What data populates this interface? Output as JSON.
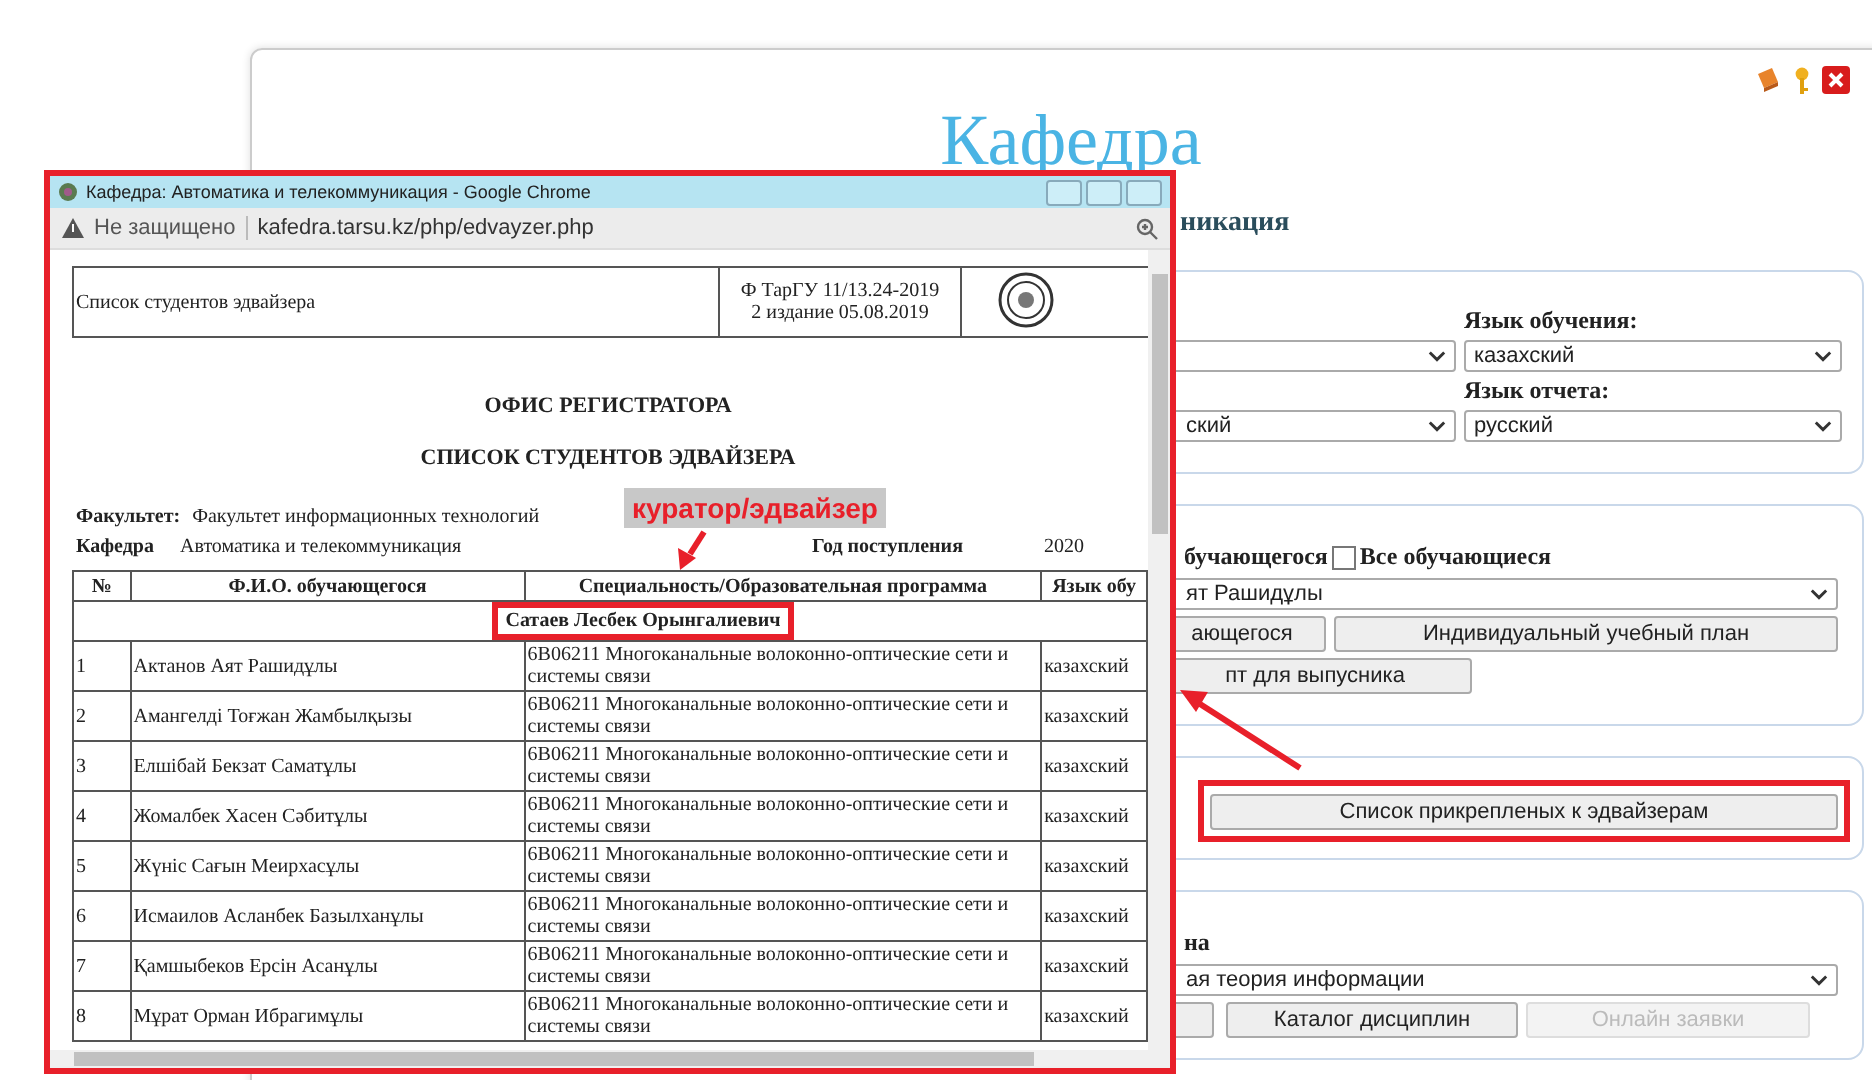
{
  "page": {
    "title": "Кафедра",
    "subtitle": "никация"
  },
  "settings_card": {
    "rows": [
      {
        "label": "Язык обучения:",
        "value": "казахский"
      },
      {
        "label": "Язык отчета:",
        "left_value": "ский",
        "value": "русский"
      }
    ]
  },
  "student_card": {
    "label": "бучающегося",
    "checkbox": {
      "label": "Все обучающиеся",
      "checked": false
    },
    "select": "ят Рашидұлы",
    "button_rows": [
      [
        {
          "label": "ающегося",
          "disabled": false
        },
        {
          "label": "Индивидуальный учебный план",
          "disabled": false
        }
      ],
      [
        {
          "label": "пт для выпусника",
          "disabled": false
        }
      ]
    ]
  },
  "advisor_card": {
    "button": "Список прикрепленых к эдвайзерам"
  },
  "discipline_card": {
    "label": "на",
    "select": "ая теория информации",
    "buttons": [
      {
        "disabled": false
      },
      {
        "label": "Каталог дисциплин",
        "disabled": false
      },
      {
        "label": "Онлайн заявки",
        "disabled": true
      }
    ]
  },
  "popup": {
    "title": "Кафедра: Автоматика и телекоммуникация - Google Chrome",
    "security": "Не защищено",
    "url": "kafedra.tarsu.kz/php/edvayzer.php",
    "doc": {
      "form_name": "Список студентов эдвайзера",
      "form_code": "Ф ТарГУ 11/13.24-2019",
      "form_edition": "2 издание 05.08.2019",
      "office": "ОФИС РЕГИСТРАТОРА",
      "heading": "СПИСОК СТУДЕНТОВ ЭДВАЙЗЕРА",
      "faculty_label": "Факультет:",
      "faculty": "Факультет информационных технологий",
      "department_label": "Кафедра",
      "department": "Автоматика и телекоммуникация",
      "year_label": "Год поступления",
      "year": "2020",
      "columns": [
        "№",
        "Ф.И.О. обучающегося",
        "Специальность/Образовательная программа",
        "Язык обу"
      ],
      "advisor": "Сатаев Лесбек Орынгалиевич",
      "rows": [
        {
          "no": "1",
          "name": "Актанов Аят Рашидұлы",
          "program": "6В06211 Многоканальные волоконно-оптические сети и системы связи",
          "language": "казахский"
        },
        {
          "no": "2",
          "name": "Амангелді Тоғжан Жамбылқызы",
          "program": "6В06211 Многоканальные волоконно-оптические сети и системы связи",
          "language": "казахский"
        },
        {
          "no": "3",
          "name": "Елшібай Бекзат Саматұлы",
          "program": "6В06211 Многоканальные волоконно-оптические сети и системы связи",
          "language": "казахский"
        },
        {
          "no": "4",
          "name": "Жомалбек Хасен Сәбитұлы",
          "program": "6В06211 Многоканальные волоконно-оптические сети и системы связи",
          "language": "казахский"
        },
        {
          "no": "5",
          "name": "Жүніс Сағын Меирхасұлы",
          "program": "6В06211 Многоканальные волоконно-оптические сети и системы связи",
          "language": "казахский"
        },
        {
          "no": "6",
          "name": "Исмаилов Асланбек Базылханұлы",
          "program": "6В06211 Многоканальные волоконно-оптические сети и системы связи",
          "language": "казахский"
        },
        {
          "no": "7",
          "name": "Қамшыбеков Ерсін Асанұлы",
          "program": "6В06211 Многоканальные волоконно-оптические сети и системы связи",
          "language": "казахский"
        },
        {
          "no": "8",
          "name": "Мұрат Орман Ибрагимұлы",
          "program": "6В06211 Многоканальные волоконно-оптические сети и системы связи",
          "language": "казахский"
        }
      ]
    }
  },
  "annotation": {
    "label": "куратор/эдвайзер"
  }
}
